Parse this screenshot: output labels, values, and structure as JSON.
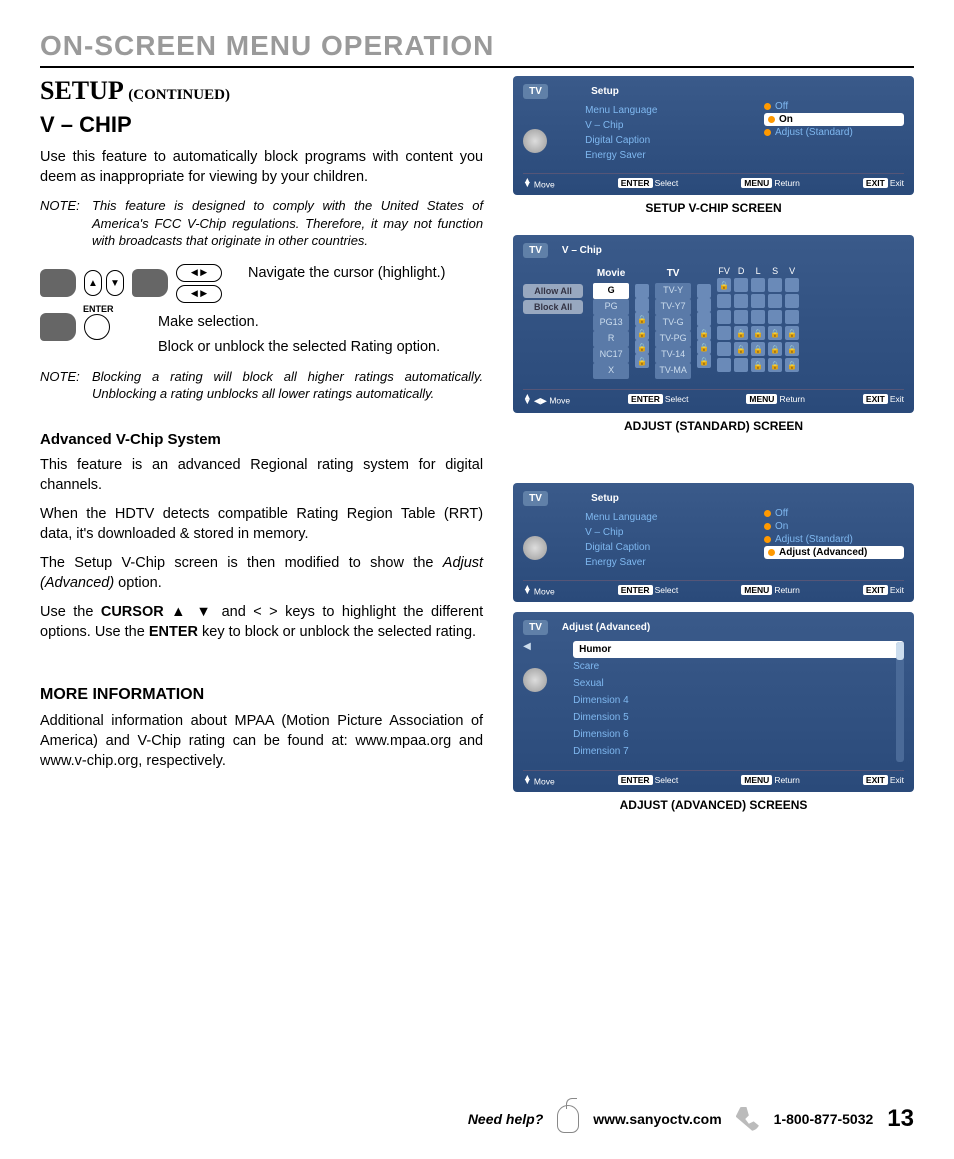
{
  "header": {
    "title": "ON-SCREEN MENU OPERATION"
  },
  "setup": {
    "main": "SETUP",
    "cont": "(CONTINUED)",
    "sub": "V – CHIP"
  },
  "intro": "Use this feature to automatically block programs with content you deem as inappropriate for viewing by your children.",
  "note1_label": "NOTE:",
  "note1": "This feature is designed to comply with the United States of America's FCC V-Chip regulations. Therefore, it may not function with broadcasts that originate in other countries.",
  "nav_text": "Navigate the cursor (highlight.)",
  "enter_label": "ENTER",
  "sel_text1": "Make selection.",
  "sel_text2": "Block or unblock the selected Rating option.",
  "note2_label": "NOTE:",
  "note2": "Blocking a rating will block all higher ratings automatically. Unblocking a rating unblocks all lower ratings automatically.",
  "adv_h": "Advanced V-Chip System",
  "adv_p1": "This feature is an advanced Regional rating system for digital channels.",
  "adv_p2": "When the HDTV detects compatible Rating Region Table (RRT) data, it's downloaded & stored in memory.",
  "adv_p3_a": "The Setup V-Chip screen is then modified to show the ",
  "adv_p3_i": "Adjust (Advanced)",
  "adv_p3_b": " option.",
  "adv_p4_a": "Use the ",
  "adv_p4_cursor": "CURSOR",
  "adv_p4_mid": " ▲ ▼  and  <  >  keys to highlight the different options. Use the ",
  "adv_p4_enter": "ENTER",
  "adv_p4_end": " key to block or unblock the selected rating.",
  "more_h": "MORE INFORMATION",
  "more_p": "Additional information about MPAA (Motion Picture Association of America) and V-Chip rating can be found at: www.mpaa.org and www.v-chip.org, respectively.",
  "screens": {
    "s1": {
      "tab_tv": "TV",
      "tab_setup": "Setup",
      "items": [
        "Menu Language",
        "V – Chip",
        "Digital Caption",
        "Energy Saver"
      ],
      "opts": [
        "Off",
        "On",
        "Adjust (Standard)"
      ],
      "sel_idx": 1,
      "foot": {
        "move": "Move",
        "enter": "ENTER",
        "select": "Select",
        "menu": "MENU",
        "return": "Return",
        "exit_b": "EXIT",
        "exit": "Exit"
      },
      "caption": "SETUP V-CHIP SCREEN"
    },
    "s2": {
      "tab_tv": "TV",
      "tab_title": "V – Chip",
      "left_btns": [
        "Allow All",
        "Block All"
      ],
      "movie_h": "Movie",
      "tv_h": "TV",
      "movie": [
        "G",
        "PG",
        "PG13",
        "R",
        "NC17",
        "X"
      ],
      "tv": [
        "TV-Y",
        "TV-Y7",
        "TV-G",
        "TV-PG",
        "TV-14",
        "TV-MA"
      ],
      "mini_heads": [
        "FV",
        "D",
        "L",
        "S",
        "V"
      ],
      "foot": {
        "move": "Move",
        "enter": "ENTER",
        "select": "Select",
        "menu": "MENU",
        "return": "Return",
        "exit_b": "EXIT",
        "exit": "Exit"
      },
      "caption": "ADJUST (STANDARD) SCREEN"
    },
    "s3": {
      "tab_tv": "TV",
      "tab_setup": "Setup",
      "items": [
        "Menu Language",
        "V – Chip",
        "Digital Caption",
        "Energy Saver"
      ],
      "opts": [
        "Off",
        "On",
        "Adjust (Standard)",
        "Adjust (Advanced)"
      ],
      "sel_idx": 3,
      "foot": {
        "move": "Move",
        "enter": "ENTER",
        "select": "Select",
        "menu": "MENU",
        "return": "Return",
        "exit_b": "EXIT",
        "exit": "Exit"
      }
    },
    "s4": {
      "tab_tv": "TV",
      "tab_title": "Adjust (Advanced)",
      "items": [
        "Humor",
        "Scare",
        "Sexual",
        "Dimension 4",
        "Dimension 5",
        "Dimension 6",
        "Dimension 7"
      ],
      "sel_idx": 0,
      "foot": {
        "move": "Move",
        "enter": "ENTER",
        "select": "Select",
        "menu": "MENU",
        "return": "Return",
        "exit_b": "EXIT",
        "exit": "Exit"
      },
      "caption": "ADJUST (ADVANCED) SCREENS"
    }
  },
  "footer": {
    "need": "Need help?",
    "url": "www.sanyoctv.com",
    "phone": "1-800-877-5032",
    "page": "13"
  }
}
